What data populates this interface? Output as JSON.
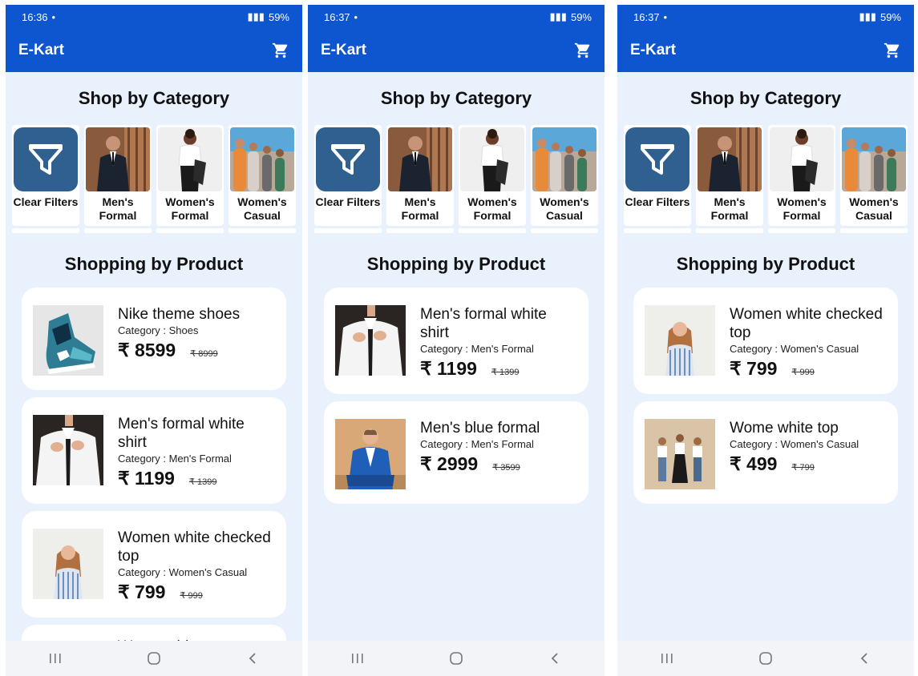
{
  "app": {
    "title": "E-Kart",
    "accent": "#0d56cf",
    "background": "#e8f1fc",
    "filter_tile_color": "#2f6090"
  },
  "sections": {
    "category_title": "Shop by Category",
    "product_title": "Shopping by Product"
  },
  "categories": [
    {
      "label": "Clear Filters",
      "icon": "filter-icon"
    },
    {
      "label": "Men's Formal",
      "icon": "mens-formal-photo"
    },
    {
      "label": "Women's Formal",
      "icon": "womens-formal-photo"
    },
    {
      "label": "Women's Casual",
      "icon": "womens-casual-photo"
    }
  ],
  "screens": [
    {
      "status": {
        "time": "16:36",
        "battery": "59%"
      },
      "products": [
        {
          "name": "Nike theme shoes",
          "category": "Category : Shoes",
          "price": "₹ 8599",
          "old_price": "₹ 8999",
          "image": "shoe-photo"
        },
        {
          "name": "Men's formal white shirt",
          "category": "Category : Men's Formal",
          "price": "₹ 1199",
          "old_price": "₹ 1399",
          "image": "white-shirt-photo"
        },
        {
          "name": "Women white checked top",
          "category": "Category : Women's Casual",
          "price": "₹ 799",
          "old_price": "₹ 999",
          "image": "checked-top-photo"
        }
      ],
      "partial_text": "Wome white top"
    },
    {
      "status": {
        "time": "16:37",
        "battery": "59%"
      },
      "products": [
        {
          "name": "Men's formal white shirt",
          "category": "Category : Men's Formal",
          "price": "₹ 1199",
          "old_price": "₹ 1399",
          "image": "white-shirt-photo"
        },
        {
          "name": "Men's blue formal",
          "category": "Category : Men's Formal",
          "price": "₹ 2999",
          "old_price": "₹ 3599",
          "image": "blue-suit-photo"
        }
      ]
    },
    {
      "status": {
        "time": "16:37",
        "battery": "59%"
      },
      "products": [
        {
          "name": "Women white checked top",
          "category": "Category : Women's Casual",
          "price": "₹ 799",
          "old_price": "₹ 999",
          "image": "checked-top-photo"
        },
        {
          "name": "Wome white top",
          "category": "Category : Women's Casual",
          "price": "₹ 499",
          "old_price": "₹ 799",
          "image": "white-top-group-photo"
        }
      ]
    }
  ]
}
